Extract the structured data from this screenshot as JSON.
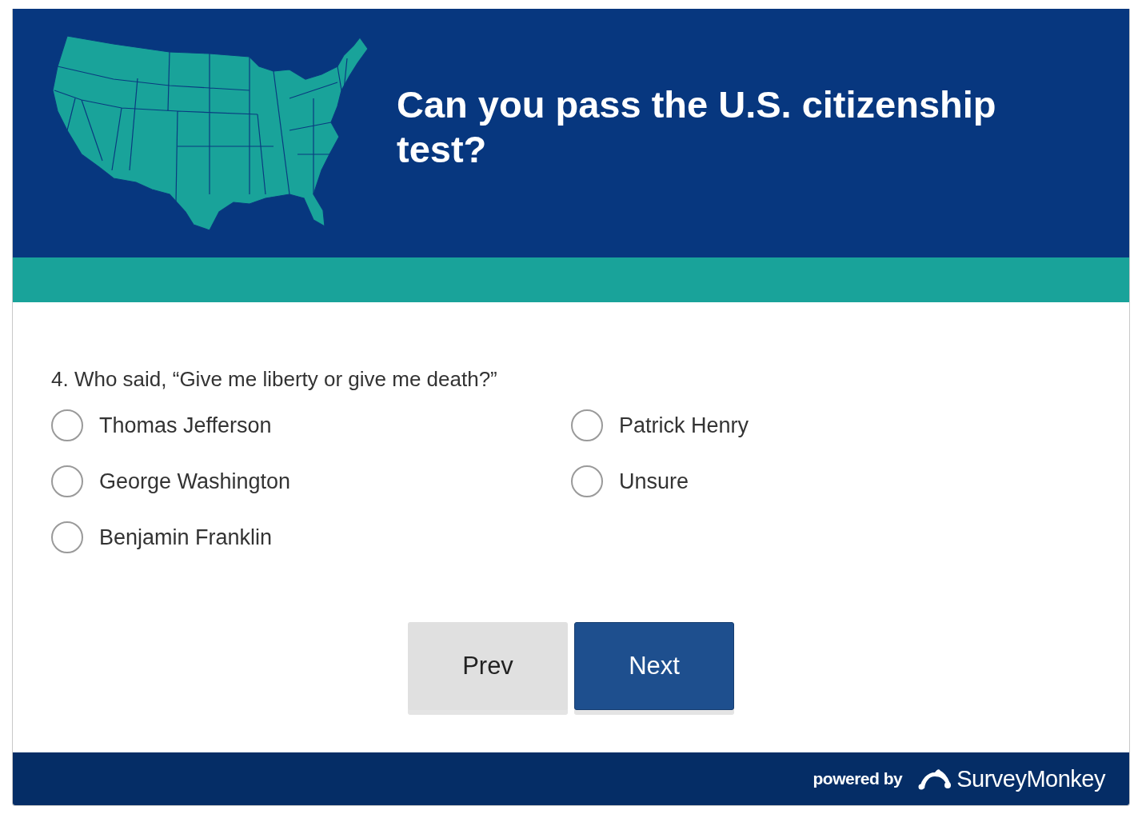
{
  "header": {
    "title": "Can you pass the U.S. citizenship test?"
  },
  "question": {
    "text": "4. Who said, “Give me liberty or give me death?”",
    "options": [
      {
        "label": "Thomas Jefferson",
        "selected": false
      },
      {
        "label": "George Washington",
        "selected": false
      },
      {
        "label": "Benjamin Franklin",
        "selected": false
      },
      {
        "label": "Patrick Henry",
        "selected": false
      },
      {
        "label": "Unsure",
        "selected": false
      }
    ]
  },
  "buttons": [
    {
      "label": "Prev",
      "kind": "secondary"
    },
    {
      "label": "Next",
      "kind": "primary"
    }
  ],
  "footer": {
    "powered_by": "powered by",
    "brand": "SurveyMonkey"
  }
}
